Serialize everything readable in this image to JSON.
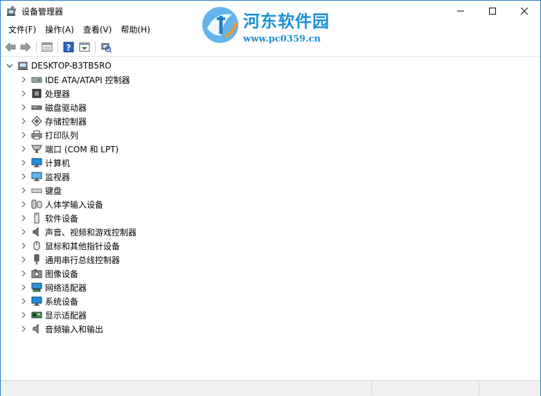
{
  "window": {
    "title": "设备管理器",
    "controls": [
      "minimize",
      "maximize",
      "close"
    ]
  },
  "watermark": {
    "name": "河东软件园",
    "url": "www.pc0359.cn"
  },
  "menu": [
    {
      "label": "文件(F)"
    },
    {
      "label": "操作(A)"
    },
    {
      "label": "查看(V)"
    },
    {
      "label": "帮助(H)"
    }
  ],
  "toolbar": {
    "buttons": [
      "back-icon",
      "forward-icon",
      "properties-icon",
      "help-icon",
      "update-driver-icon",
      "scan-hardware-icon"
    ]
  },
  "tree": {
    "root": {
      "label": "DESKTOP-B3TB5RO",
      "icon": "computer-icon",
      "expanded": true
    },
    "items": [
      {
        "label": "IDE ATA/ATAPI 控制器",
        "icon": "ide-controller-icon"
      },
      {
        "label": "处理器",
        "icon": "processor-icon"
      },
      {
        "label": "磁盘驱动器",
        "icon": "disk-drive-icon"
      },
      {
        "label": "存储控制器",
        "icon": "storage-controller-icon"
      },
      {
        "label": "打印队列",
        "icon": "printer-icon"
      },
      {
        "label": "端口 (COM 和 LPT)",
        "icon": "port-icon"
      },
      {
        "label": "计算机",
        "icon": "computer-monitor-icon"
      },
      {
        "label": "监视器",
        "icon": "monitor-icon"
      },
      {
        "label": "键盘",
        "icon": "keyboard-icon"
      },
      {
        "label": "人体学输入设备",
        "icon": "hid-icon"
      },
      {
        "label": "软件设备",
        "icon": "software-device-icon"
      },
      {
        "label": "声音、视频和游戏控制器",
        "icon": "speaker-icon"
      },
      {
        "label": "鼠标和其他指针设备",
        "icon": "mouse-icon"
      },
      {
        "label": "通用串行总线控制器",
        "icon": "usb-icon"
      },
      {
        "label": "图像设备",
        "icon": "camera-icon"
      },
      {
        "label": "网络适配器",
        "icon": "network-adapter-icon"
      },
      {
        "label": "系统设备",
        "icon": "system-device-icon"
      },
      {
        "label": "显示适配器",
        "icon": "display-adapter-icon"
      },
      {
        "label": "音频输入和输出",
        "icon": "audio-io-icon"
      }
    ]
  },
  "colors": {
    "border": "#2b79d6",
    "watermark": "#1b8fd8",
    "status_bar": "#f0f0f0"
  }
}
